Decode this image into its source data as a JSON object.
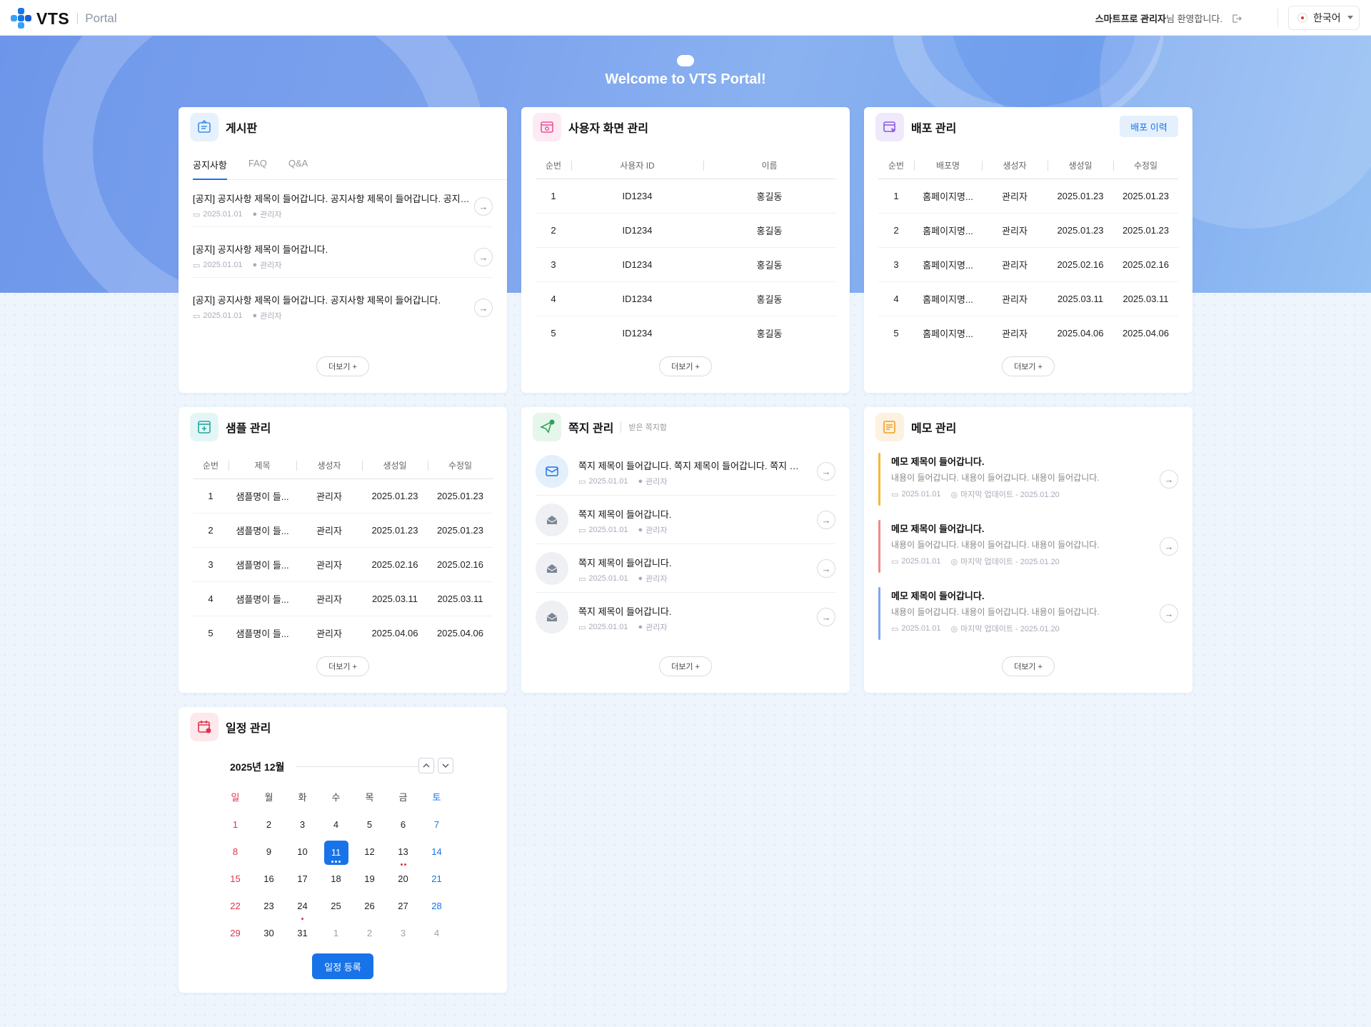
{
  "header": {
    "logo_text": "VTS",
    "portal_text": "Portal",
    "user_name": "스마트프로 관리자",
    "welcome_suffix": "님 환영합니다.",
    "language": "한국어"
  },
  "hero": {
    "title": "Welcome to VTS Portal!"
  },
  "board": {
    "title": "게시판",
    "tabs": [
      "공지사항",
      "FAQ",
      "Q&A"
    ],
    "items": [
      {
        "title": "[공지] 공지사항 제목이 들어갑니다. 공지사항 제목이 들어갑니다. 공지사항 제목이 들어갑니다.",
        "date": "2025.01.01",
        "author": "관리자"
      },
      {
        "title": "[공지] 공지사항 제목이 들어갑니다.",
        "date": "2025.01.01",
        "author": "관리자"
      },
      {
        "title": "[공지] 공지사항 제목이 들어갑니다. 공지사항 제목이 들어갑니다.",
        "date": "2025.01.01",
        "author": "관리자"
      }
    ],
    "more": "더보기 +"
  },
  "user_screen": {
    "title": "사용자 화면 관리",
    "columns": [
      "순번",
      "사용자 ID",
      "이름"
    ],
    "rows": [
      [
        "1",
        "ID1234",
        "홍길동"
      ],
      [
        "2",
        "ID1234",
        "홍길동"
      ],
      [
        "3",
        "ID1234",
        "홍길동"
      ],
      [
        "4",
        "ID1234",
        "홍길동"
      ],
      [
        "5",
        "ID1234",
        "홍길동"
      ]
    ],
    "more": "더보기 +"
  },
  "deploy": {
    "title": "배포 관리",
    "history_button": "배포 이력",
    "columns": [
      "순번",
      "배포명",
      "생성자",
      "생성일",
      "수정일"
    ],
    "rows": [
      [
        "1",
        "홈페이지명...",
        "관리자",
        "2025.01.23",
        "2025.01.23"
      ],
      [
        "2",
        "홈페이지명...",
        "관리자",
        "2025.01.23",
        "2025.01.23"
      ],
      [
        "3",
        "홈페이지명...",
        "관리자",
        "2025.02.16",
        "2025.02.16"
      ],
      [
        "4",
        "홈페이지명...",
        "관리자",
        "2025.03.11",
        "2025.03.11"
      ],
      [
        "5",
        "홈페이지명...",
        "관리자",
        "2025.04.06",
        "2025.04.06"
      ]
    ],
    "more": "더보기 +"
  },
  "sample": {
    "title": "샘플 관리",
    "columns": [
      "순번",
      "제목",
      "생성자",
      "생성일",
      "수정일"
    ],
    "rows": [
      [
        "1",
        "샘플명이 들...",
        "관리자",
        "2025.01.23",
        "2025.01.23"
      ],
      [
        "2",
        "샘플명이 들...",
        "관리자",
        "2025.01.23",
        "2025.01.23"
      ],
      [
        "3",
        "샘플명이 들...",
        "관리자",
        "2025.02.16",
        "2025.02.16"
      ],
      [
        "4",
        "샘플명이 들...",
        "관리자",
        "2025.03.11",
        "2025.03.11"
      ],
      [
        "5",
        "샘플명이 들...",
        "관리자",
        "2025.04.06",
        "2025.04.06"
      ]
    ],
    "more": "더보기 +"
  },
  "message": {
    "title": "쪽지 관리",
    "subtitle": "받은 쪽지함",
    "items": [
      {
        "title": "쪽지 제목이 들어갑니다. 쪽지 제목이 들어갑니다. 쪽지 제목이 들어갑니다.",
        "date": "2025.01.01",
        "author": "관리자",
        "unread": true
      },
      {
        "title": "쪽지 제목이 들어갑니다.",
        "date": "2025.01.01",
        "author": "관리자",
        "unread": false
      },
      {
        "title": "쪽지 제목이 들어갑니다.",
        "date": "2025.01.01",
        "author": "관리자",
        "unread": false
      },
      {
        "title": "쪽지 제목이 들어갑니다.",
        "date": "2025.01.01",
        "author": "관리자",
        "unread": false
      }
    ],
    "more": "더보기 +"
  },
  "memo": {
    "title": "메모 관리",
    "items": [
      {
        "title": "메모 제목이 들어갑니다.",
        "content": "내용이 들어갑니다. 내용이 들어갑니다. 내용이 들어갑니다.",
        "date": "2025.01.01",
        "updated": "마지막 업데이트 - 2025.01.20",
        "color": "#f5b732"
      },
      {
        "title": "메모 제목이 들어갑니다.",
        "content": "내용이 들어갑니다. 내용이 들어갑니다. 내용이 들어갑니다.",
        "date": "2025.01.01",
        "updated": "마지막 업데이트 - 2025.01.20",
        "color": "#f08a8a"
      },
      {
        "title": "메모 제목이 들어갑니다.",
        "content": "내용이 들어갑니다. 내용이 들어갑니다. 내용이 들어갑니다.",
        "date": "2025.01.01",
        "updated": "마지막 업데이트 - 2025.01.20",
        "color": "#7fa6f0"
      }
    ],
    "more": "더보기 +"
  },
  "schedule": {
    "title": "일정 관리",
    "month_label": "2025년 12월",
    "weekdays": [
      "일",
      "월",
      "화",
      "수",
      "목",
      "금",
      "토"
    ],
    "weeks": [
      [
        "1",
        "2",
        "3",
        "4",
        "5",
        "6",
        "7"
      ],
      [
        "8",
        "9",
        "10",
        "11",
        "12",
        "13",
        "14"
      ],
      [
        "15",
        "16",
        "17",
        "18",
        "19",
        "20",
        "21"
      ],
      [
        "22",
        "23",
        "24",
        "25",
        "26",
        "27",
        "28"
      ],
      [
        "29",
        "30",
        "31",
        "1",
        "2",
        "3",
        "4"
      ]
    ],
    "today": "11",
    "event_dots": {
      "11": [
        "#1973e8",
        "#1973e8",
        "#1973e8"
      ],
      "13": [
        "#e0334a",
        "#e0334a"
      ],
      "24": [
        "#e0334a"
      ]
    },
    "register_button": "일정 등록"
  },
  "colors": {
    "accent": "#1973e8",
    "sunday": "#e0334a",
    "saturday": "#1973e8"
  }
}
